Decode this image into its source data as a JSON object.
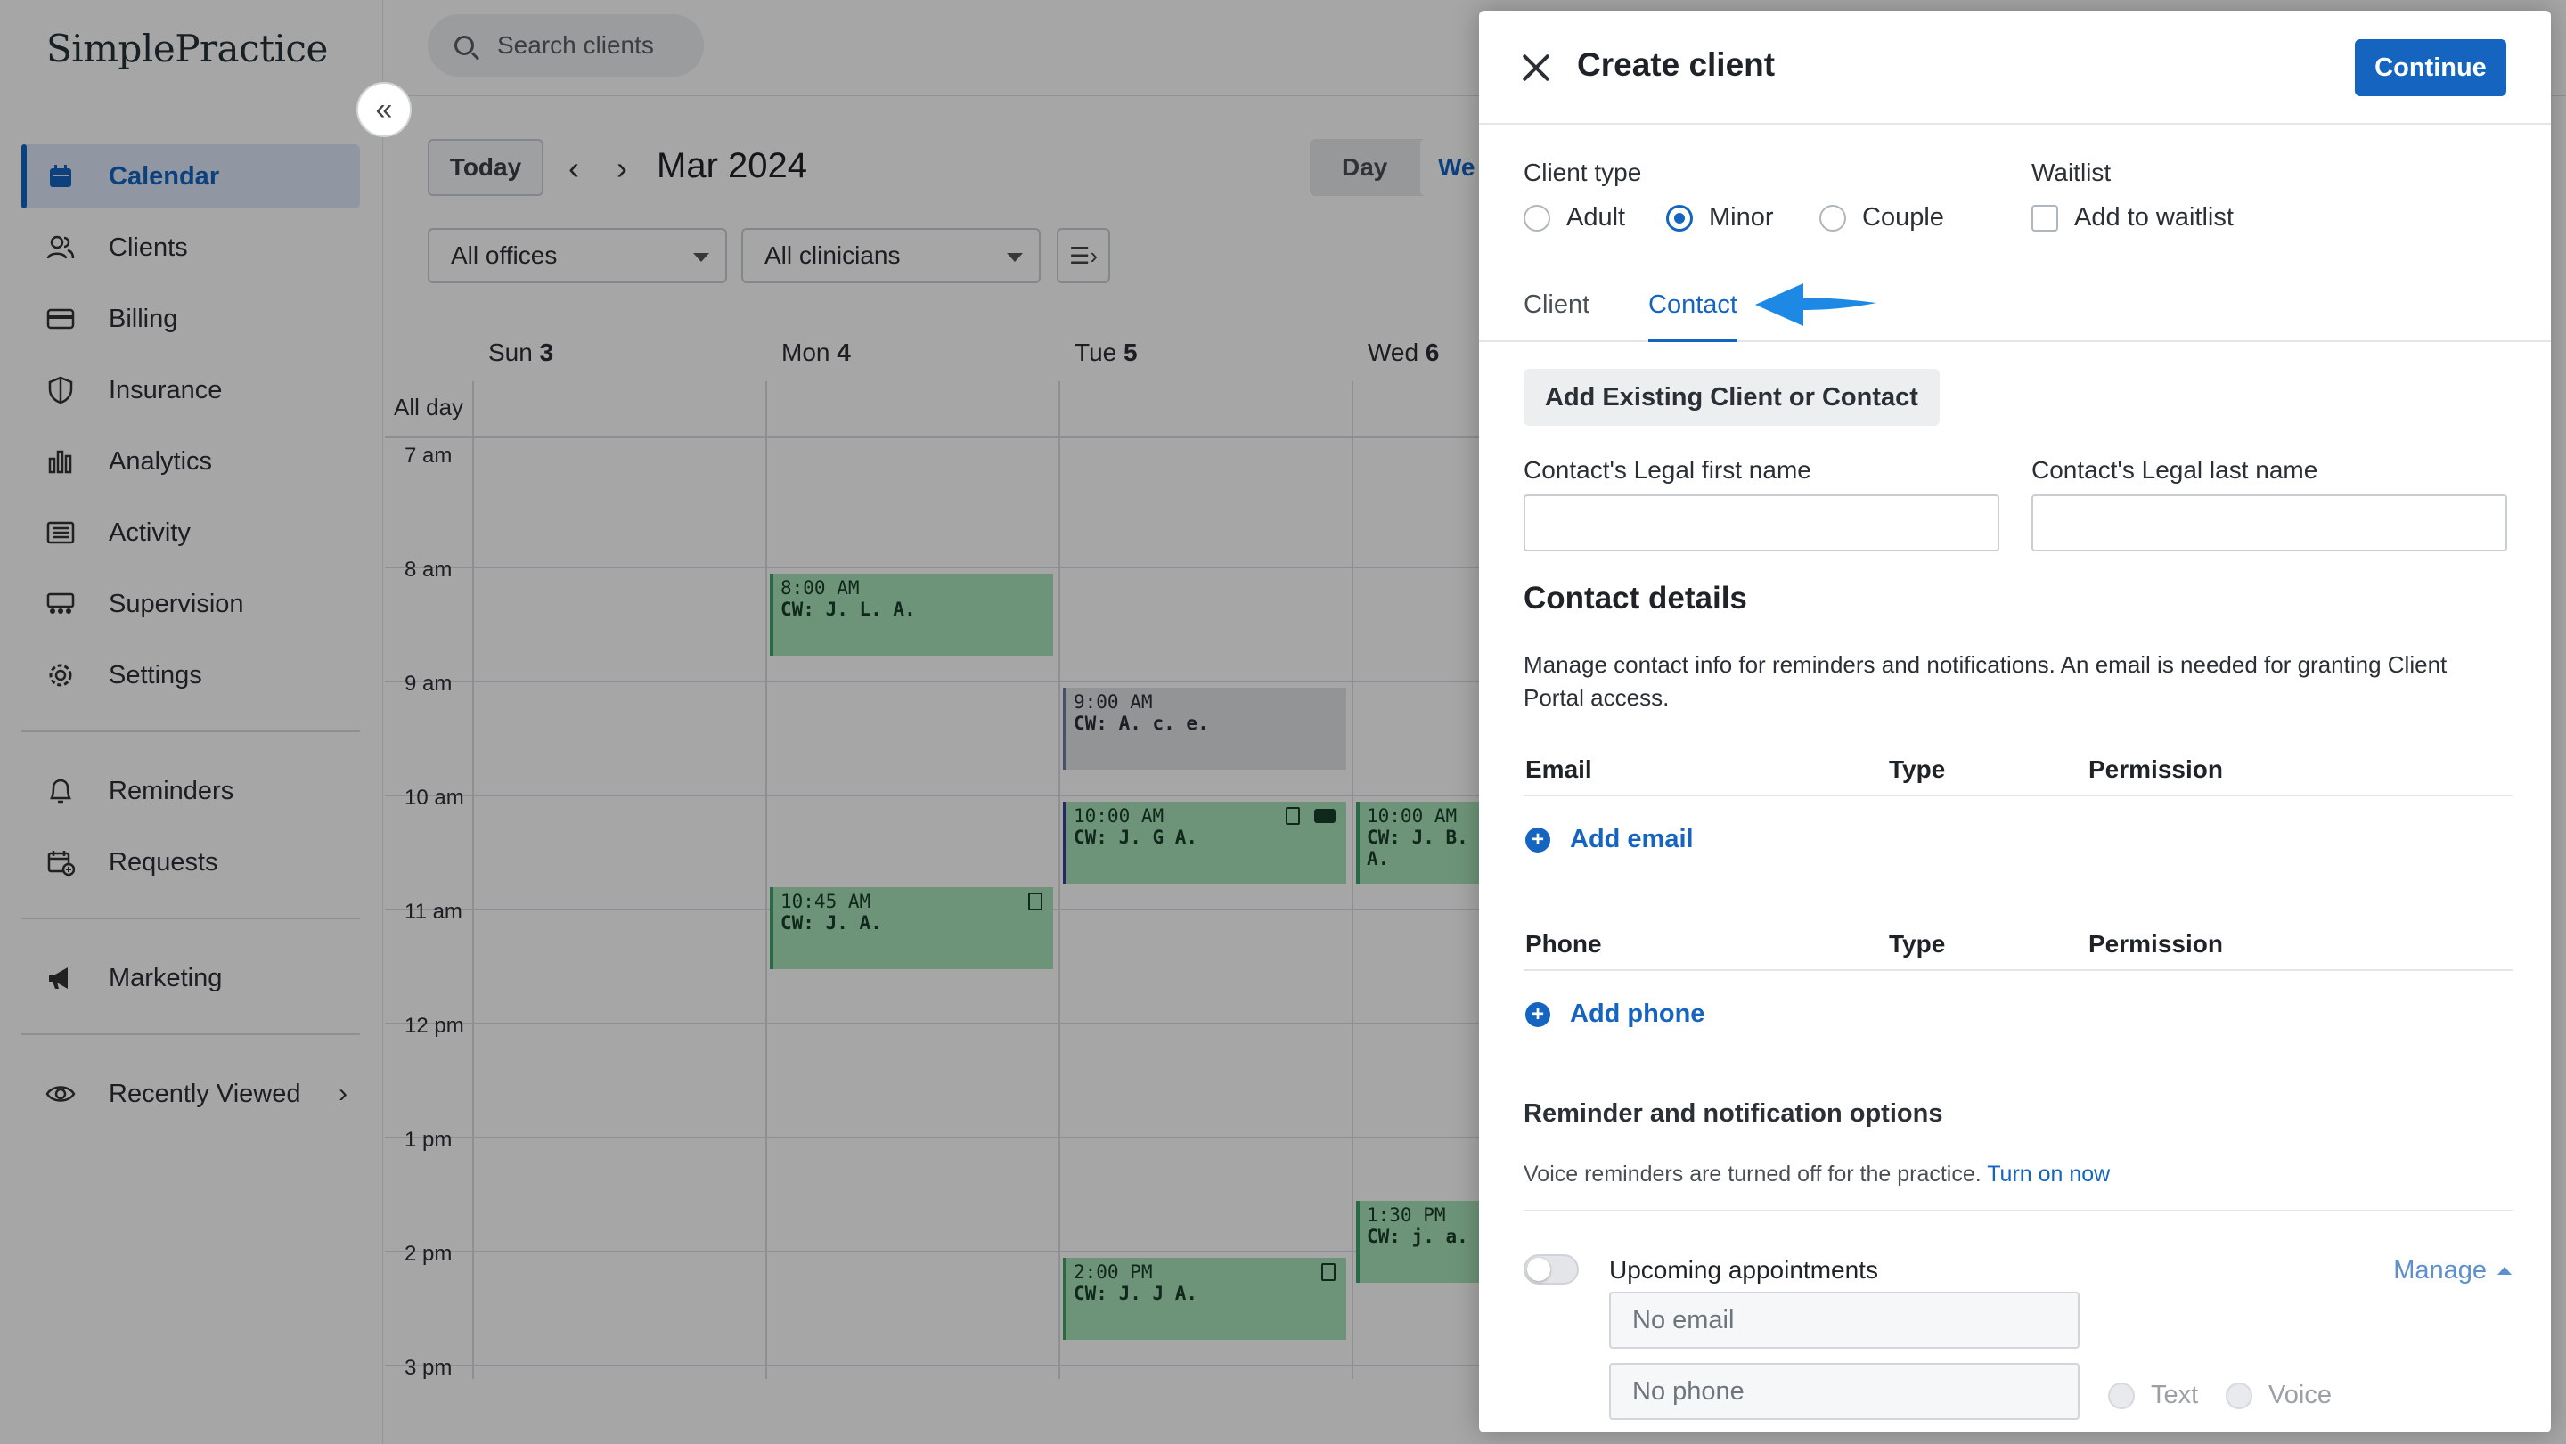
{
  "app": {
    "logo": "SimplePractice",
    "search_placeholder": "Search clients",
    "nav": [
      {
        "label": "Calendar",
        "icon": "calendar-icon"
      },
      {
        "label": "Clients",
        "icon": "users-icon"
      },
      {
        "label": "Billing",
        "icon": "credit-card-icon"
      },
      {
        "label": "Insurance",
        "icon": "shield-icon"
      },
      {
        "label": "Analytics",
        "icon": "bar-chart-icon"
      },
      {
        "label": "Activity",
        "icon": "list-icon"
      },
      {
        "label": "Supervision",
        "icon": "supervision-icon"
      },
      {
        "label": "Settings",
        "icon": "gear-icon"
      }
    ],
    "nav2": [
      {
        "label": "Reminders",
        "icon": "bell-icon"
      },
      {
        "label": "Requests",
        "icon": "calendar-plus-icon"
      }
    ],
    "nav3": [
      {
        "label": "Marketing",
        "icon": "megaphone-icon"
      }
    ],
    "recently_viewed": "Recently Viewed",
    "calendar": {
      "today": "Today",
      "month": "Mar 2024",
      "view_day": "Day",
      "view_week": "We",
      "offices": "All offices",
      "clinicians": "All clinicians",
      "days": [
        {
          "name": "Sun",
          "num": "3"
        },
        {
          "name": "Mon",
          "num": "4"
        },
        {
          "name": "Tue",
          "num": "5"
        },
        {
          "name": "Wed",
          "num": "6"
        }
      ],
      "all_day": "All day",
      "hours": [
        "7 am",
        "8 am",
        "9 am",
        "10 am",
        "11 am",
        "12 pm",
        "1 pm",
        "2 pm",
        "3 pm"
      ],
      "events": [
        {
          "time": "8:00 AM",
          "who": "CW: J. L. A."
        },
        {
          "time": "9:00 AM",
          "who": "CW: A. c. e."
        },
        {
          "time": "10:00 AM",
          "who": "CW: J. G A."
        },
        {
          "time": "10:00 AM",
          "who": "CW: J. B. A."
        },
        {
          "time": "10:45 AM",
          "who": "CW: J. A."
        },
        {
          "time": "1:30 PM",
          "who": "CW: j. a."
        },
        {
          "time": "2:00 PM",
          "who": "CW: J. J A."
        }
      ]
    }
  },
  "drawer": {
    "title": "Create client",
    "continue": "Continue",
    "client_type_label": "Client type",
    "client_types": [
      "Adult",
      "Minor",
      "Couple"
    ],
    "selected_client_type": "Minor",
    "waitlist_label": "Waitlist",
    "waitlist_option": "Add to waitlist",
    "tabs": [
      "Client",
      "Contact"
    ],
    "active_tab": "Contact",
    "add_existing": "Add Existing Client or Contact",
    "first_name_label": "Contact's Legal first name",
    "last_name_label": "Contact's Legal last name",
    "contact_details_heading": "Contact details",
    "contact_details_desc": "Manage contact info for reminders and notifications. An email is needed for granting Client Portal access.",
    "email_header": "Email",
    "type_header": "Type",
    "permission_header": "Permission",
    "add_email": "Add email",
    "phone_header": "Phone",
    "add_phone": "Add phone",
    "reminder_heading": "Reminder and notification options",
    "voice_note": "Voice reminders are turned off for the practice.",
    "turn_on_now": "Turn on now",
    "upcoming_label": "Upcoming appointments",
    "manage": "Manage",
    "no_email": "No email",
    "no_phone": "No phone",
    "text_option": "Text",
    "voice_option": "Voice",
    "accent": "#1565c0"
  }
}
